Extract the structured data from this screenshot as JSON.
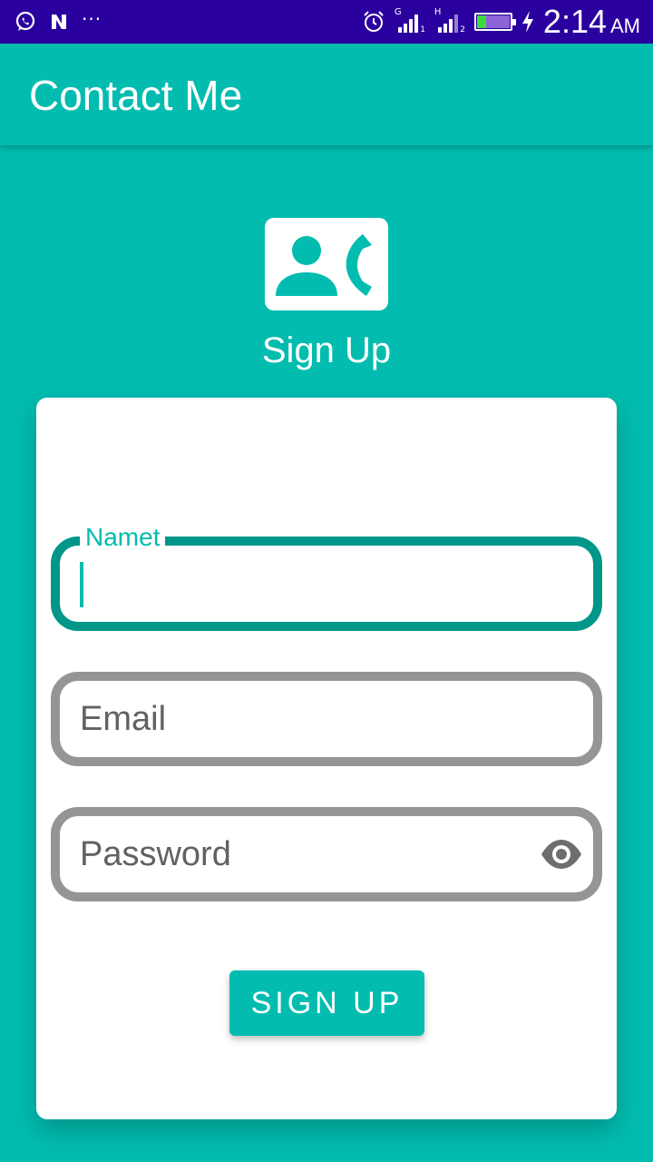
{
  "status_bar": {
    "notification_icons": [
      "whatsapp-icon",
      "n-icon"
    ],
    "overflow": "···",
    "sim1": {
      "type": "G",
      "slot": "1"
    },
    "sim2": {
      "type": "H",
      "slot": "2"
    },
    "time": "2:14",
    "ampm": "AM"
  },
  "app_bar": {
    "title": "Contact Me"
  },
  "hero": {
    "icon": "contact-phone-icon",
    "heading": "Sign Up"
  },
  "form": {
    "name": {
      "label": "Namet",
      "value": ""
    },
    "email": {
      "placeholder": "Email"
    },
    "password": {
      "placeholder": "Password",
      "toggle_icon": "eye-icon"
    },
    "submit_label": "SIGN UP"
  },
  "colors": {
    "primary": "#02bcaf",
    "primary_dark": "#00968a",
    "status_bar": "#2a009e",
    "field_border": "#959595"
  }
}
